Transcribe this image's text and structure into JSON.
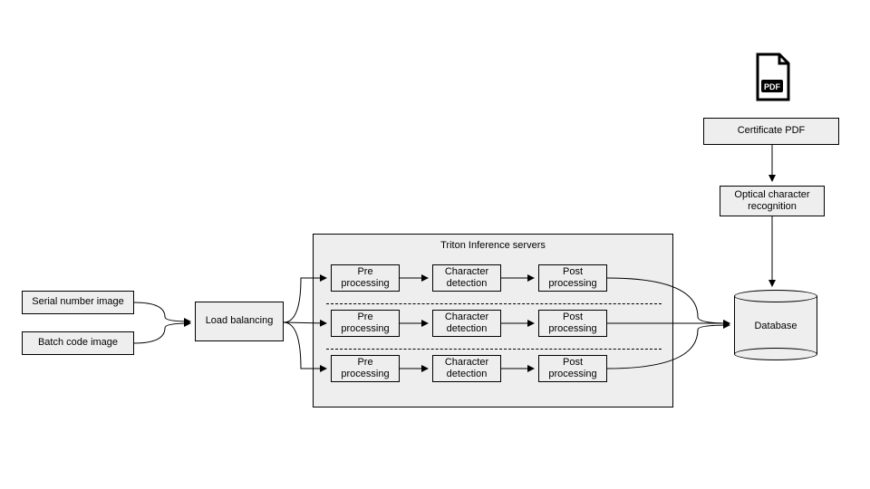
{
  "inputs": {
    "serial": "Serial number image",
    "batch": "Batch code image"
  },
  "load_balancer": "Load balancing",
  "triton": {
    "title": "Triton Inference servers",
    "rows": [
      {
        "pre": "Pre processing",
        "char": "Character detection",
        "post": "Post processing"
      },
      {
        "pre": "Pre processing",
        "char": "Character detection",
        "post": "Post processing"
      },
      {
        "pre": "Pre processing",
        "char": "Character detection",
        "post": "Post processing"
      }
    ]
  },
  "pdf_pipeline": {
    "icon": "pdf-icon",
    "cert": "Certificate PDF",
    "ocr": "Optical character recognition"
  },
  "database": "Database"
}
